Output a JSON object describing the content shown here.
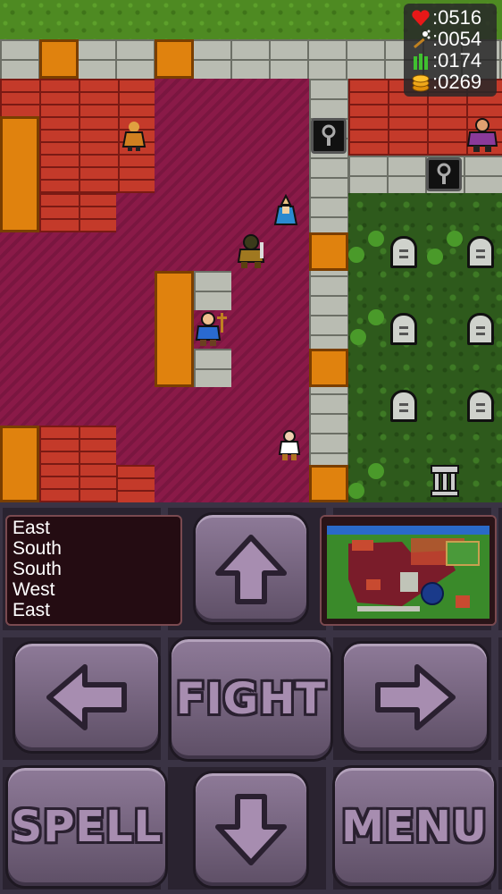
{
  "stats": {
    "hp": ":0516",
    "magic": ":0054",
    "food": ":0174",
    "gold": ":0269"
  },
  "log": [
    "East",
    "South",
    "South",
    "West",
    "East"
  ],
  "buttons": {
    "up": "up-arrow",
    "left": "left-arrow",
    "right": "right-arrow",
    "down": "down-arrow",
    "fight": "FIGHT",
    "spell": "SPELL",
    "menu": "MENU"
  },
  "colors": {
    "carpet": "#8a1a48",
    "brick": "#c43a2a",
    "stone": "#b9bcb2",
    "grass": "#4e8a22",
    "door": "#e0820e",
    "button": "#7a6a84"
  },
  "icons": {
    "hp": "heart-icon",
    "magic": "wand-icon",
    "food": "food-icon",
    "gold": "coins-icon"
  }
}
